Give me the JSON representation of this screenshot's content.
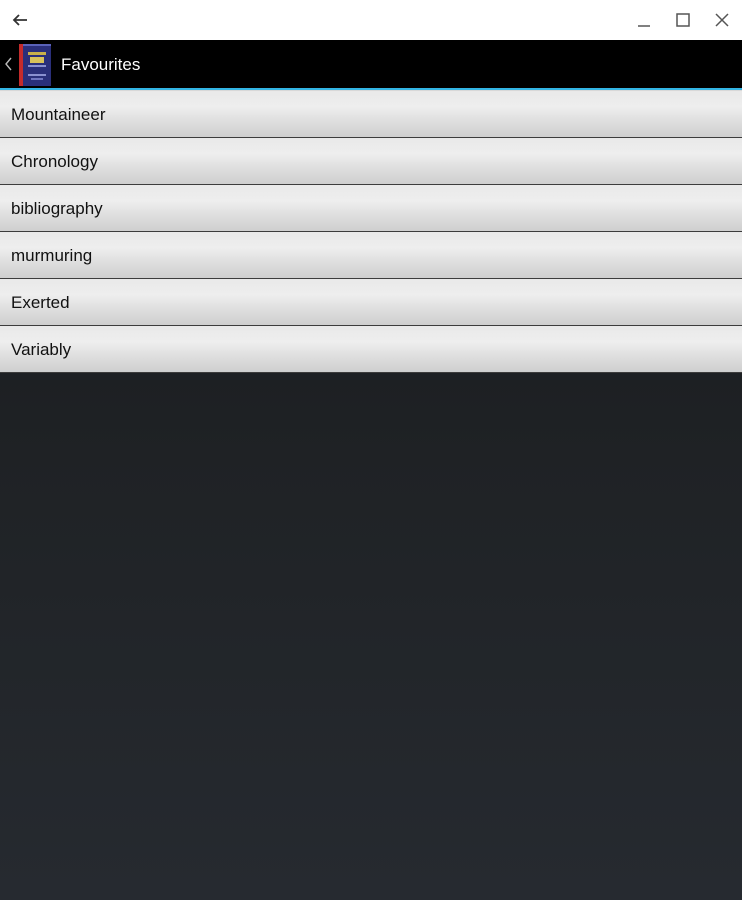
{
  "window": {
    "back_icon": "arrow-left-icon",
    "controls": [
      "minimize-icon",
      "maximize-icon",
      "close-icon"
    ]
  },
  "action_bar": {
    "title": "Favourites",
    "up_icon": "chevron-left-icon",
    "logo": "dictionary-book-logo",
    "accent_color": "#33b5e5",
    "background_color": "#000000"
  },
  "favourites": [
    {
      "word": "Mountaineer"
    },
    {
      "word": "Chronology"
    },
    {
      "word": "bibliography"
    },
    {
      "word": "murmuring"
    },
    {
      "word": "Exerted"
    },
    {
      "word": "Variably"
    }
  ]
}
